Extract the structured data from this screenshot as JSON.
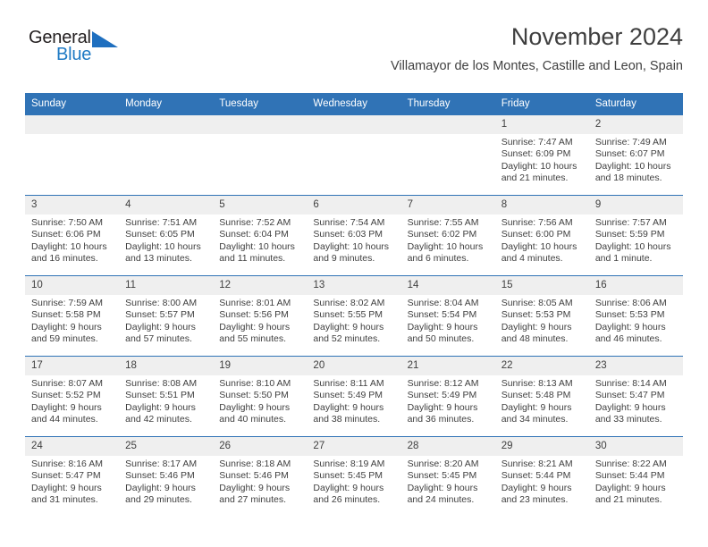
{
  "logo": {
    "word1": "General",
    "word2": "Blue",
    "triangle_color": "#1f6fbf",
    "word2_color": "#1f7ac4"
  },
  "header": {
    "month_title": "November 2024",
    "location": "Villamayor de los Montes, Castille and Leon, Spain"
  },
  "theme": {
    "header_blue": "#3073b6",
    "daynum_band": "#efefef",
    "text": "#3f3f3f"
  },
  "weekday_headers": [
    "Sunday",
    "Monday",
    "Tuesday",
    "Wednesday",
    "Thursday",
    "Friday",
    "Saturday"
  ],
  "weeks": [
    [
      {
        "day": "",
        "sunrise": "",
        "sunset": "",
        "daylight_line1": "",
        "daylight_line2": ""
      },
      {
        "day": "",
        "sunrise": "",
        "sunset": "",
        "daylight_line1": "",
        "daylight_line2": ""
      },
      {
        "day": "",
        "sunrise": "",
        "sunset": "",
        "daylight_line1": "",
        "daylight_line2": ""
      },
      {
        "day": "",
        "sunrise": "",
        "sunset": "",
        "daylight_line1": "",
        "daylight_line2": ""
      },
      {
        "day": "",
        "sunrise": "",
        "sunset": "",
        "daylight_line1": "",
        "daylight_line2": ""
      },
      {
        "day": "1",
        "sunrise": "Sunrise: 7:47 AM",
        "sunset": "Sunset: 6:09 PM",
        "daylight_line1": "Daylight: 10 hours",
        "daylight_line2": "and 21 minutes."
      },
      {
        "day": "2",
        "sunrise": "Sunrise: 7:49 AM",
        "sunset": "Sunset: 6:07 PM",
        "daylight_line1": "Daylight: 10 hours",
        "daylight_line2": "and 18 minutes."
      }
    ],
    [
      {
        "day": "3",
        "sunrise": "Sunrise: 7:50 AM",
        "sunset": "Sunset: 6:06 PM",
        "daylight_line1": "Daylight: 10 hours",
        "daylight_line2": "and 16 minutes."
      },
      {
        "day": "4",
        "sunrise": "Sunrise: 7:51 AM",
        "sunset": "Sunset: 6:05 PM",
        "daylight_line1": "Daylight: 10 hours",
        "daylight_line2": "and 13 minutes."
      },
      {
        "day": "5",
        "sunrise": "Sunrise: 7:52 AM",
        "sunset": "Sunset: 6:04 PM",
        "daylight_line1": "Daylight: 10 hours",
        "daylight_line2": "and 11 minutes."
      },
      {
        "day": "6",
        "sunrise": "Sunrise: 7:54 AM",
        "sunset": "Sunset: 6:03 PM",
        "daylight_line1": "Daylight: 10 hours",
        "daylight_line2": "and 9 minutes."
      },
      {
        "day": "7",
        "sunrise": "Sunrise: 7:55 AM",
        "sunset": "Sunset: 6:02 PM",
        "daylight_line1": "Daylight: 10 hours",
        "daylight_line2": "and 6 minutes."
      },
      {
        "day": "8",
        "sunrise": "Sunrise: 7:56 AM",
        "sunset": "Sunset: 6:00 PM",
        "daylight_line1": "Daylight: 10 hours",
        "daylight_line2": "and 4 minutes."
      },
      {
        "day": "9",
        "sunrise": "Sunrise: 7:57 AM",
        "sunset": "Sunset: 5:59 PM",
        "daylight_line1": "Daylight: 10 hours",
        "daylight_line2": "and 1 minute."
      }
    ],
    [
      {
        "day": "10",
        "sunrise": "Sunrise: 7:59 AM",
        "sunset": "Sunset: 5:58 PM",
        "daylight_line1": "Daylight: 9 hours",
        "daylight_line2": "and 59 minutes."
      },
      {
        "day": "11",
        "sunrise": "Sunrise: 8:00 AM",
        "sunset": "Sunset: 5:57 PM",
        "daylight_line1": "Daylight: 9 hours",
        "daylight_line2": "and 57 minutes."
      },
      {
        "day": "12",
        "sunrise": "Sunrise: 8:01 AM",
        "sunset": "Sunset: 5:56 PM",
        "daylight_line1": "Daylight: 9 hours",
        "daylight_line2": "and 55 minutes."
      },
      {
        "day": "13",
        "sunrise": "Sunrise: 8:02 AM",
        "sunset": "Sunset: 5:55 PM",
        "daylight_line1": "Daylight: 9 hours",
        "daylight_line2": "and 52 minutes."
      },
      {
        "day": "14",
        "sunrise": "Sunrise: 8:04 AM",
        "sunset": "Sunset: 5:54 PM",
        "daylight_line1": "Daylight: 9 hours",
        "daylight_line2": "and 50 minutes."
      },
      {
        "day": "15",
        "sunrise": "Sunrise: 8:05 AM",
        "sunset": "Sunset: 5:53 PM",
        "daylight_line1": "Daylight: 9 hours",
        "daylight_line2": "and 48 minutes."
      },
      {
        "day": "16",
        "sunrise": "Sunrise: 8:06 AM",
        "sunset": "Sunset: 5:53 PM",
        "daylight_line1": "Daylight: 9 hours",
        "daylight_line2": "and 46 minutes."
      }
    ],
    [
      {
        "day": "17",
        "sunrise": "Sunrise: 8:07 AM",
        "sunset": "Sunset: 5:52 PM",
        "daylight_line1": "Daylight: 9 hours",
        "daylight_line2": "and 44 minutes."
      },
      {
        "day": "18",
        "sunrise": "Sunrise: 8:08 AM",
        "sunset": "Sunset: 5:51 PM",
        "daylight_line1": "Daylight: 9 hours",
        "daylight_line2": "and 42 minutes."
      },
      {
        "day": "19",
        "sunrise": "Sunrise: 8:10 AM",
        "sunset": "Sunset: 5:50 PM",
        "daylight_line1": "Daylight: 9 hours",
        "daylight_line2": "and 40 minutes."
      },
      {
        "day": "20",
        "sunrise": "Sunrise: 8:11 AM",
        "sunset": "Sunset: 5:49 PM",
        "daylight_line1": "Daylight: 9 hours",
        "daylight_line2": "and 38 minutes."
      },
      {
        "day": "21",
        "sunrise": "Sunrise: 8:12 AM",
        "sunset": "Sunset: 5:49 PM",
        "daylight_line1": "Daylight: 9 hours",
        "daylight_line2": "and 36 minutes."
      },
      {
        "day": "22",
        "sunrise": "Sunrise: 8:13 AM",
        "sunset": "Sunset: 5:48 PM",
        "daylight_line1": "Daylight: 9 hours",
        "daylight_line2": "and 34 minutes."
      },
      {
        "day": "23",
        "sunrise": "Sunrise: 8:14 AM",
        "sunset": "Sunset: 5:47 PM",
        "daylight_line1": "Daylight: 9 hours",
        "daylight_line2": "and 33 minutes."
      }
    ],
    [
      {
        "day": "24",
        "sunrise": "Sunrise: 8:16 AM",
        "sunset": "Sunset: 5:47 PM",
        "daylight_line1": "Daylight: 9 hours",
        "daylight_line2": "and 31 minutes."
      },
      {
        "day": "25",
        "sunrise": "Sunrise: 8:17 AM",
        "sunset": "Sunset: 5:46 PM",
        "daylight_line1": "Daylight: 9 hours",
        "daylight_line2": "and 29 minutes."
      },
      {
        "day": "26",
        "sunrise": "Sunrise: 8:18 AM",
        "sunset": "Sunset: 5:46 PM",
        "daylight_line1": "Daylight: 9 hours",
        "daylight_line2": "and 27 minutes."
      },
      {
        "day": "27",
        "sunrise": "Sunrise: 8:19 AM",
        "sunset": "Sunset: 5:45 PM",
        "daylight_line1": "Daylight: 9 hours",
        "daylight_line2": "and 26 minutes."
      },
      {
        "day": "28",
        "sunrise": "Sunrise: 8:20 AM",
        "sunset": "Sunset: 5:45 PM",
        "daylight_line1": "Daylight: 9 hours",
        "daylight_line2": "and 24 minutes."
      },
      {
        "day": "29",
        "sunrise": "Sunrise: 8:21 AM",
        "sunset": "Sunset: 5:44 PM",
        "daylight_line1": "Daylight: 9 hours",
        "daylight_line2": "and 23 minutes."
      },
      {
        "day": "30",
        "sunrise": "Sunrise: 8:22 AM",
        "sunset": "Sunset: 5:44 PM",
        "daylight_line1": "Daylight: 9 hours",
        "daylight_line2": "and 21 minutes."
      }
    ]
  ]
}
